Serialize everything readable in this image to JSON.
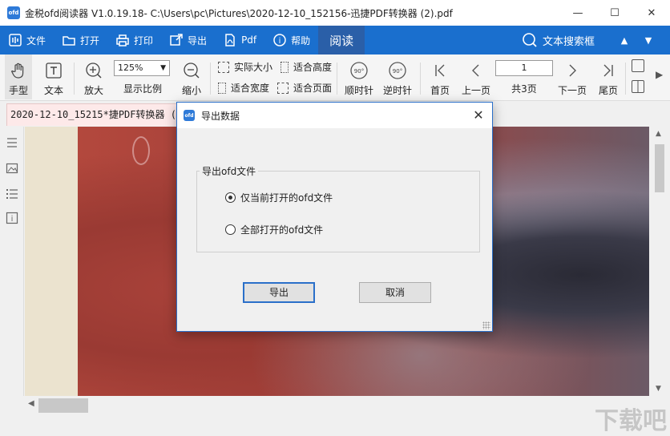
{
  "window": {
    "title": "金税ofd阅读器 V1.0.19.18- C:\\Users\\pc\\Pictures\\2020-12-10_152156-迅捷PDF转换器 (2).pdf",
    "logo": "ofd",
    "controls": {
      "minimize": "—",
      "maximize": "☐",
      "close": "✕"
    }
  },
  "menubar": {
    "items": [
      {
        "label": "文件",
        "icon": "file-icon"
      },
      {
        "label": "打开",
        "icon": "folder-icon"
      },
      {
        "label": "打印",
        "icon": "printer-icon"
      },
      {
        "label": "导出",
        "icon": "export-icon"
      },
      {
        "label": "Pdf",
        "icon": "pdf-icon"
      },
      {
        "label": "帮助",
        "icon": "help-icon"
      }
    ],
    "active": "阅读",
    "search_label": "文本搜索框",
    "up": "▲",
    "down": "▼"
  },
  "toolbar": {
    "hand": "手型",
    "text": "文本",
    "zoom_in": "放大",
    "zoom_value": "125%",
    "zoom_ratio": "显示比例",
    "zoom_out": "缩小",
    "actual_size": "实际大小",
    "fit_height": "适合高度",
    "fit_width": "适合宽度",
    "fit_page": "适合页面",
    "rotate_cw": "顺时针",
    "rotate_ccw": "逆时针",
    "rotate_label": "90°",
    "first_page": "首页",
    "prev_page": "上一页",
    "page_number": "1",
    "page_total": "共3页",
    "next_page": "下一页",
    "last_page": "尾页"
  },
  "tab": {
    "label": "2020-12-10_15215*捷PDF转换器 (2).p"
  },
  "dialog": {
    "title": "导出数据",
    "logo": "ofd",
    "close": "✕",
    "group_label": "导出ofd文件",
    "options": [
      {
        "label": "仅当前打开的ofd文件",
        "checked": true
      },
      {
        "label": "全部打开的ofd文件",
        "checked": false
      }
    ],
    "ok": "导出",
    "cancel": "取消"
  },
  "watermark": "下载吧"
}
